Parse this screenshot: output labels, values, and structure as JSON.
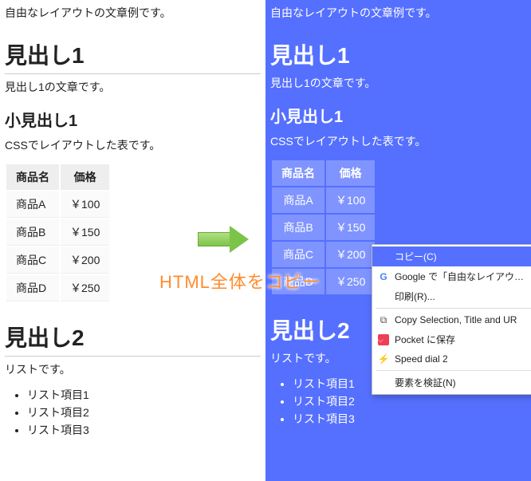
{
  "content": {
    "intro": "自由なレイアウトの文章例です。",
    "h1_1": "見出し1",
    "p_h1": "見出し1の文章です。",
    "h2_1": "小見出し1",
    "p_table": "CSSでレイアウトした表です。",
    "table": {
      "headers": [
        "商品名",
        "価格"
      ],
      "rows": [
        [
          "商品A",
          "￥100"
        ],
        [
          "商品B",
          "￥150"
        ],
        [
          "商品C",
          "￥200"
        ],
        [
          "商品D",
          "￥250"
        ]
      ]
    },
    "h1_2": "見出し2",
    "p_list": "リストです。",
    "list": [
      "リスト項目1",
      "リスト項目2",
      "リスト項目3"
    ]
  },
  "overlay": {
    "label": "HTML全体をコピー"
  },
  "context_menu": {
    "copy": "コピー(C)",
    "google": "Google で「自由なレイアウトの文章",
    "print": "印刷(R)...",
    "copy_sel": "Copy Selection, Title and UR",
    "pocket": "Pocket に保存",
    "speed": "Speed dial 2",
    "inspect": "要素を検証(N)"
  }
}
